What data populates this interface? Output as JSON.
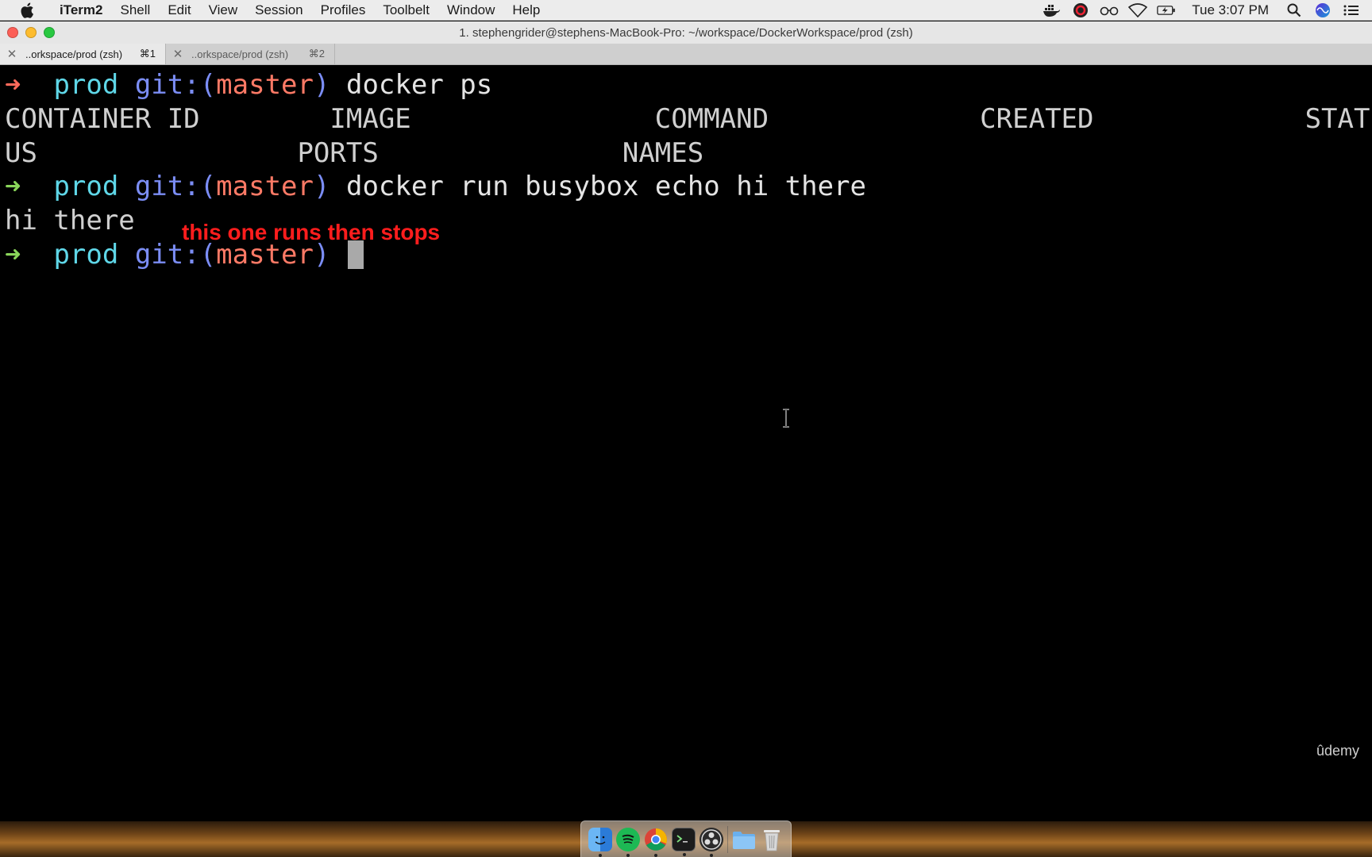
{
  "menubar": {
    "app_name": "iTerm2",
    "items": [
      "Shell",
      "Edit",
      "View",
      "Session",
      "Profiles",
      "Toolbelt",
      "Window",
      "Help"
    ],
    "clock": "Tue 3:07 PM",
    "status_icons": [
      "docker-icon",
      "creative-cloud-icon",
      "glasses-icon",
      "wifi-icon",
      "battery-icon",
      "spotlight-search-icon",
      "siri-icon",
      "notification-center-icon"
    ]
  },
  "window": {
    "title": "1. stephengrider@stephens-MacBook-Pro: ~/workspace/DockerWorkspace/prod (zsh)"
  },
  "tabs": [
    {
      "label": "..orkspace/prod (zsh)",
      "shortcut": "⌘1",
      "active": true
    },
    {
      "label": "..orkspace/prod (zsh)",
      "shortcut": "⌘2",
      "active": false
    }
  ],
  "terminal": {
    "prompt": {
      "arrow": "➜",
      "dir": "prod",
      "git_prefix": "git:(",
      "branch": "master",
      "git_suffix": ")"
    },
    "line1_cmd": "docker ps",
    "header_line1": "CONTAINER ID        IMAGE               COMMAND             CREATED             STAT",
    "header_line2": "US                PORTS               NAMES",
    "line4_cmd": "docker run busybox echo hi there",
    "output_line": "hi there",
    "annotation": "this one runs then stops",
    "watermark": "ûdemy"
  },
  "colors": {
    "prompt_arrow_ok": "#8ad55a",
    "prompt_arrow_err": "#ff6a5b",
    "dir": "#5fd7e8",
    "git": "#7b8df5",
    "branch": "#ff7a66",
    "annotation": "#ff1d1d"
  },
  "dock": {
    "apps": [
      "finder-icon",
      "spotify-icon",
      "chrome-icon",
      "terminal-icon",
      "obs-icon",
      "folder-icon",
      "trash-icon"
    ]
  }
}
